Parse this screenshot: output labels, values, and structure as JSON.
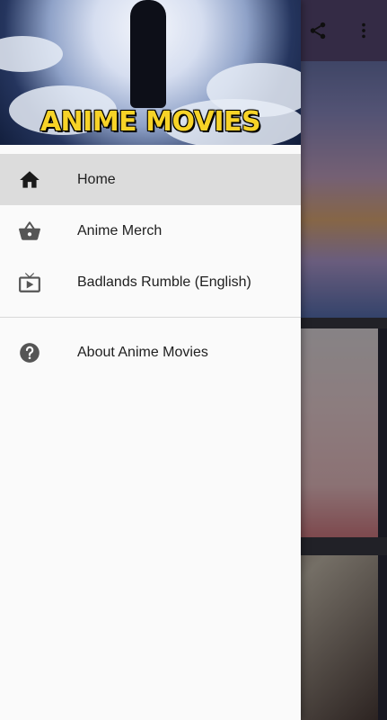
{
  "drawer": {
    "header_title": "ANIME MOVIES",
    "items": [
      {
        "label": "Home",
        "icon": "home-icon",
        "selected": true
      },
      {
        "label": "Anime Merch",
        "icon": "shopping-basket-icon",
        "selected": false
      },
      {
        "label": "Badlands Rumble (English)",
        "icon": "live-tv-icon",
        "selected": false
      }
    ],
    "secondary_items": [
      {
        "label": "About Anime Movies",
        "icon": "help-circle-icon"
      }
    ]
  },
  "toolbar": {
    "actions": [
      "share-icon",
      "more-vertical-icon"
    ]
  },
  "colors": {
    "toolbar": "#5b4a78",
    "title_yellow": "#f7d327",
    "selected_bg": "#dcdcdc",
    "icon_gray": "#555555"
  }
}
